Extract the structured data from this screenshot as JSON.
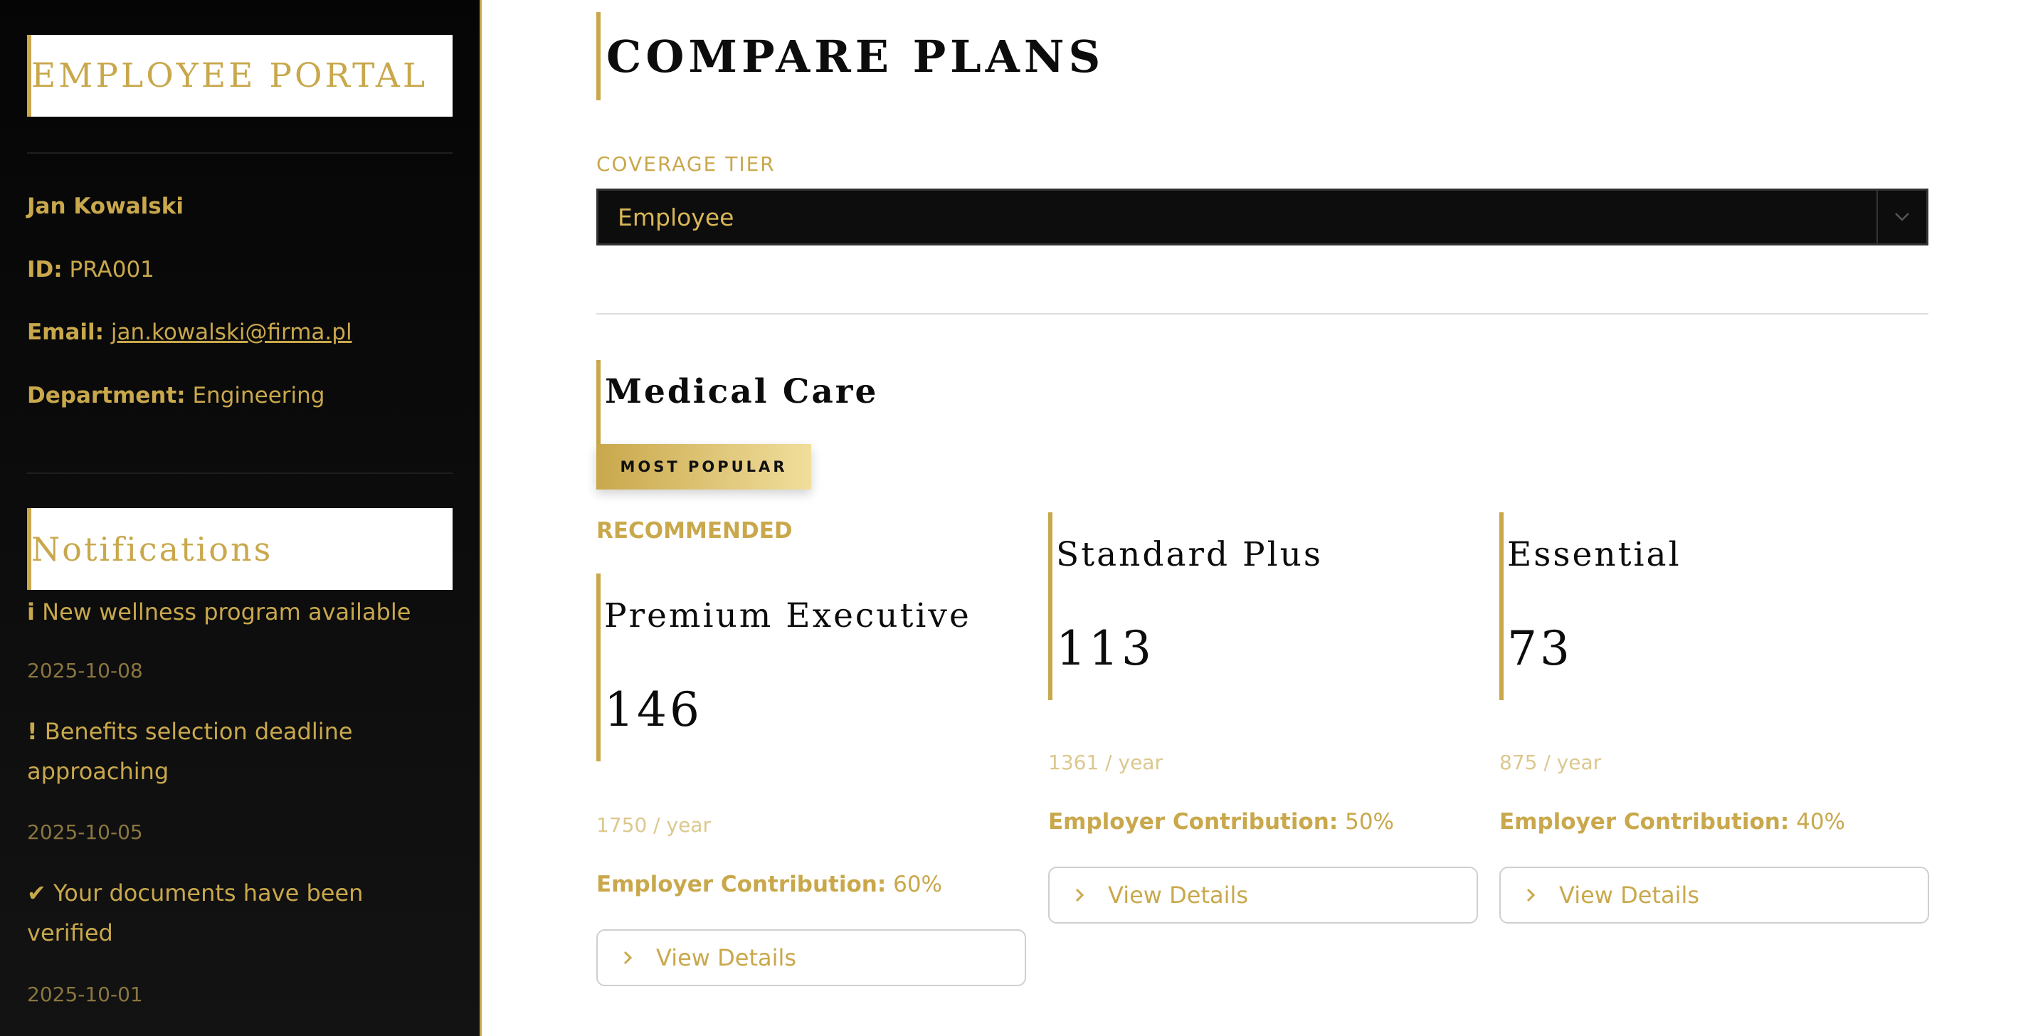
{
  "sidebar": {
    "portal_title": "EMPLOYEE PORTAL",
    "user": {
      "name": "Jan Kowalski",
      "id_label": "ID:",
      "id_value": "PRA001",
      "email_label": "Email:",
      "email_value": "jan.kowalski@firma.pl",
      "department_label": "Department:",
      "department_value": "Engineering"
    },
    "notifications_title": "Notifications",
    "notifications": [
      {
        "glyph": "i",
        "text": "New wellness program available",
        "date": "2025-10-08"
      },
      {
        "glyph": "!",
        "text": "Benefits selection deadline approaching",
        "date": "2025-10-05"
      },
      {
        "glyph": "✔",
        "text": "Your documents have been verified",
        "date": "2025-10-01"
      }
    ]
  },
  "main": {
    "title": "COMPARE PLANS",
    "coverage_label": "COVERAGE TIER",
    "coverage_value": "Employee",
    "section_title": "Medical Care",
    "badge": "MOST POPULAR",
    "recommended_label": "RECOMMENDED",
    "contribution_label": "Employer Contribution:",
    "details_label": "View Details",
    "plans": [
      {
        "name": "Premium Executive",
        "price": "146",
        "yearly": "1750 / year",
        "contribution": "60%"
      },
      {
        "name": "Standard Plus",
        "price": "113",
        "yearly": "1361 / year",
        "contribution": "50%"
      },
      {
        "name": "Essential",
        "price": "73",
        "yearly": "875 / year",
        "contribution": "40%"
      }
    ]
  },
  "colors": {
    "accent": "#c9a84c",
    "sidebar_bg": "#0a0a0a",
    "text_dark": "#0c0c0c"
  }
}
